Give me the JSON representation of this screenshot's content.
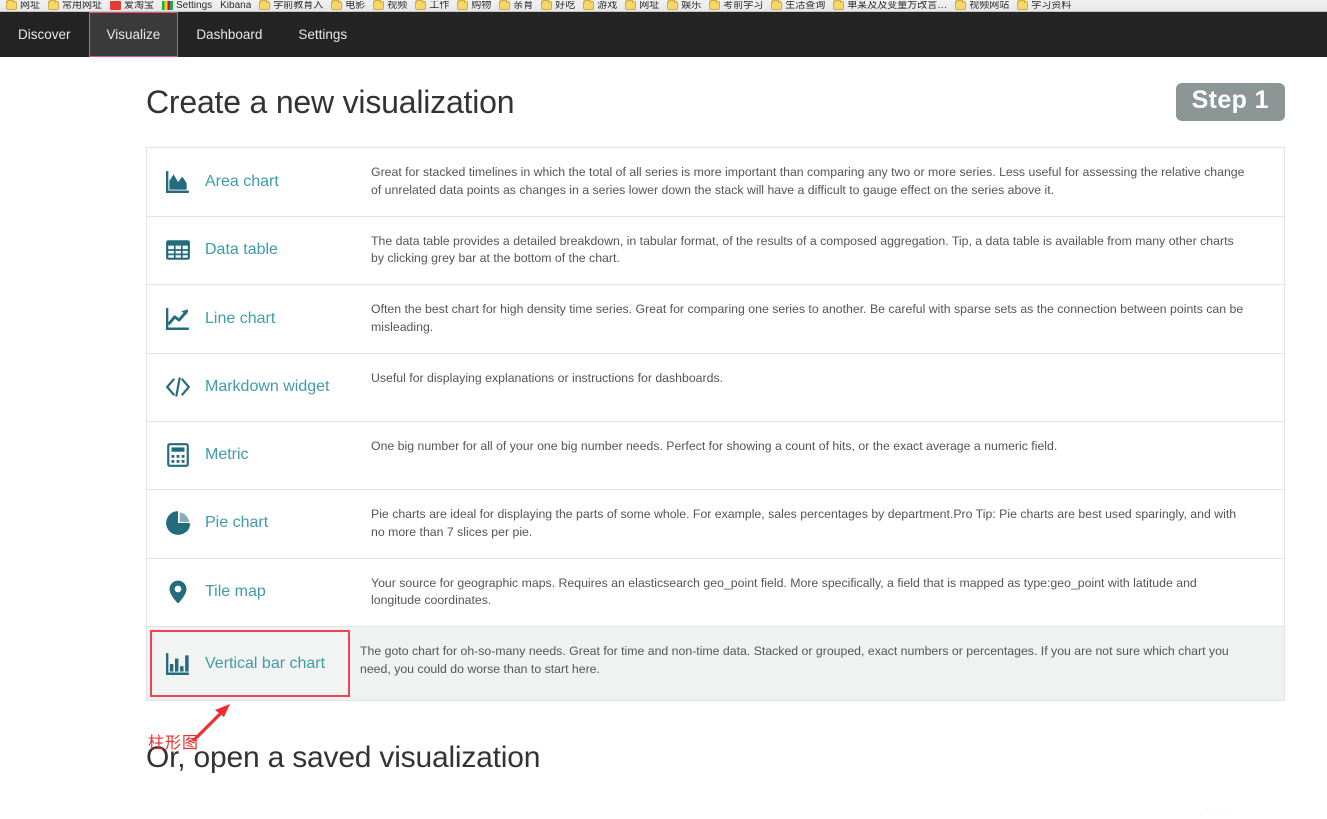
{
  "browser": {
    "bookmarks": [
      {
        "icon": "folder-icon",
        "label": "网址"
      },
      {
        "icon": "folder-icon",
        "label": "常用网址"
      },
      {
        "icon": "red-square-icon",
        "label": "爱淘宝"
      },
      {
        "icon": "rainbow-icon",
        "label": "Settings"
      },
      {
        "icon": "none",
        "label": "Kibana"
      },
      {
        "icon": "folder-icon",
        "label": "学前教育入"
      },
      {
        "icon": "folder-icon",
        "label": "电影"
      },
      {
        "icon": "folder-icon",
        "label": "视频"
      },
      {
        "icon": "folder-icon",
        "label": "工作"
      },
      {
        "icon": "folder-icon",
        "label": "购物"
      },
      {
        "icon": "folder-icon",
        "label": "亲育"
      },
      {
        "icon": "folder-icon",
        "label": "好吃"
      },
      {
        "icon": "folder-icon",
        "label": "游戏"
      },
      {
        "icon": "folder-icon",
        "label": "网址"
      },
      {
        "icon": "folder-icon",
        "label": "娱乐"
      },
      {
        "icon": "folder-icon",
        "label": "考前学习"
      },
      {
        "icon": "folder-icon",
        "label": "生活查询"
      },
      {
        "icon": "folder-icon",
        "label": "单某及及变量方改言…"
      },
      {
        "icon": "folder-icon",
        "label": "视频网站"
      },
      {
        "icon": "folder-icon",
        "label": "学习资料"
      }
    ]
  },
  "nav": {
    "tabs": [
      {
        "label": "Discover",
        "active": false
      },
      {
        "label": "Visualize",
        "active": true
      },
      {
        "label": "Dashboard",
        "active": false
      },
      {
        "label": "Settings",
        "active": false
      }
    ]
  },
  "main": {
    "title": "Create a new visualization",
    "step_badge": "Step 1",
    "saved_title": "Or, open a saved visualization",
    "footer_ghost": "· · · ·",
    "viz_types": [
      {
        "icon": "area-chart-icon",
        "name": "Area chart",
        "description": "Great for stacked timelines in which the total of all series is more important than comparing any two or more series. Less useful for assessing the relative change of unrelated data points as changes in a series lower down the stack will have a difficult to gauge effect on the series above it.",
        "selected": false
      },
      {
        "icon": "data-table-icon",
        "name": "Data table",
        "description": "The data table provides a detailed breakdown, in tabular format, of the results of a composed aggregation. Tip, a data table is available from many other charts by clicking grey bar at the bottom of the chart.",
        "selected": false
      },
      {
        "icon": "line-chart-icon",
        "name": "Line chart",
        "description": "Often the best chart for high density time series. Great for comparing one series to another. Be careful with sparse sets as the connection between points can be misleading.",
        "selected": false
      },
      {
        "icon": "markdown-code-icon",
        "name": "Markdown widget",
        "description": "Useful for displaying explanations or instructions for dashboards.",
        "selected": false
      },
      {
        "icon": "metric-calculator-icon",
        "name": "Metric",
        "description": "One big number for all of your one big number needs. Perfect for showing a count of hits, or the exact average a numeric field.",
        "selected": false
      },
      {
        "icon": "pie-chart-icon",
        "name": "Pie chart",
        "description": "Pie charts are ideal for displaying the parts of some whole. For example, sales percentages by department.Pro Tip: Pie charts are best used sparingly, and with no more than 7 slices per pie.",
        "selected": false
      },
      {
        "icon": "map-pin-icon",
        "name": "Tile map",
        "description": "Your source for geographic maps. Requires an elasticsearch geo_point field. More specifically, a field that is mapped as type:geo_point with latitude and longitude coordinates.",
        "selected": false
      },
      {
        "icon": "vertical-bar-chart-icon",
        "name": "Vertical bar chart",
        "description": "The goto chart for oh-so-many needs. Great for time and non-time data. Stacked or grouped, exact numbers or percentages. If you are not sure which chart you need, you could do worse than to start here.",
        "selected": true
      }
    ]
  },
  "annotation": {
    "label": "柱形图",
    "color": "#ee2d2d"
  },
  "colors": {
    "nav_background": "#242424",
    "link_teal": "#3f9ca8",
    "icon_teal": "#236b7d",
    "badge_gray": "#8b9695",
    "highlight_red": "#ee4452",
    "row_selected_bg": "#f0f2f1"
  }
}
